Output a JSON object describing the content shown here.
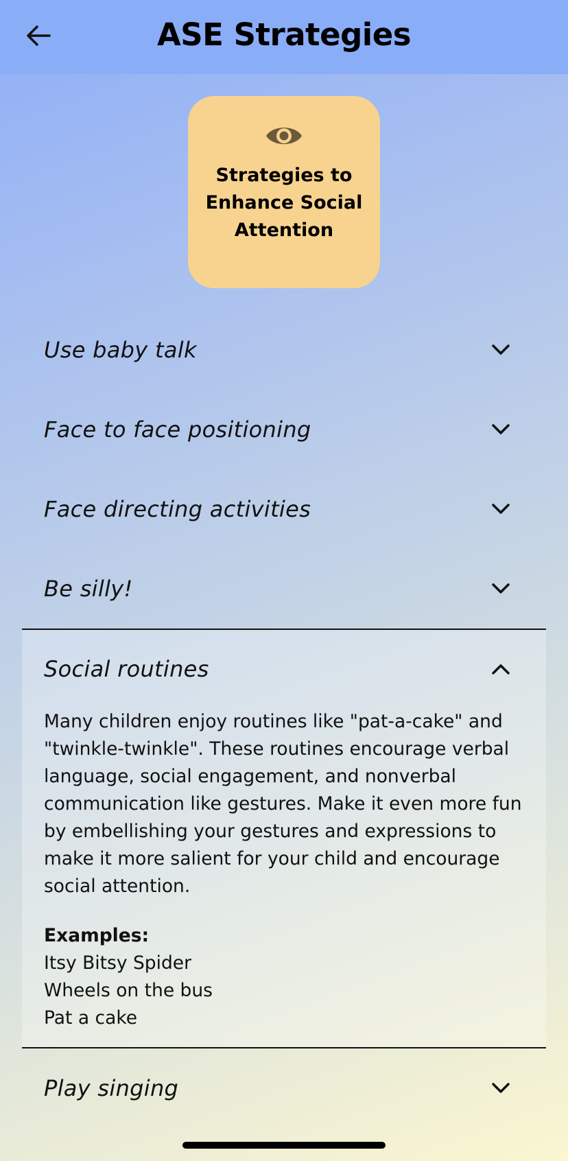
{
  "header": {
    "title": "ASE Strategies",
    "back_icon": "arrow-left-icon"
  },
  "category": {
    "icon": "eye-icon",
    "title": "Strategies to Enhance Social Attention",
    "color": "#f7d38f"
  },
  "strategies": [
    {
      "label": "Use baby talk",
      "expanded": false
    },
    {
      "label": "Face to face positioning",
      "expanded": false
    },
    {
      "label": "Face directing activities",
      "expanded": false
    },
    {
      "label": "Be silly!",
      "expanded": false
    },
    {
      "label": "Social routines",
      "expanded": true,
      "description": "Many children enjoy routines like \"pat-a-cake\" and \"twinkle-twinkle\". These routines encourage verbal language, social engagement, and nonverbal communication like gestures. Make it even more fun by embellishing your gestures and expressions to make it more salient for your child and encourage social attention.",
      "examples_heading": "Examples:",
      "examples": [
        "Itsy Bitsy Spider",
        "Wheels on the bus",
        "Pat a cake"
      ]
    },
    {
      "label": "Play singing",
      "expanded": false
    }
  ],
  "colors": {
    "header_bg": "#8aadf7",
    "card_bg": "#f7d38f"
  }
}
